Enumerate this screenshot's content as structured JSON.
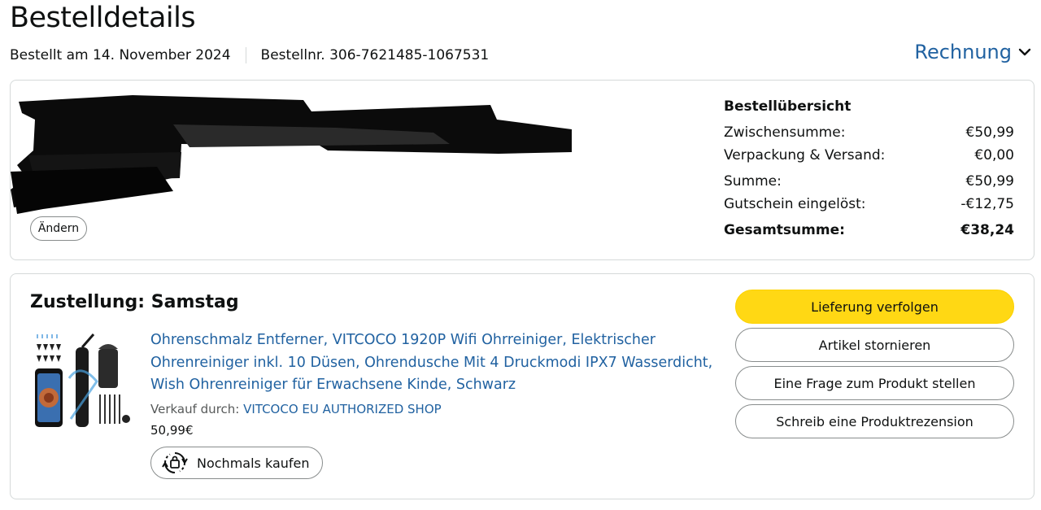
{
  "header": {
    "title": "Bestelldetails",
    "order_date": "Bestellt am 14. November 2024",
    "order_number": "Bestellnr. 306-7621485-1067531",
    "invoice_label": "Rechnung"
  },
  "address": {
    "change_label": "Ändern"
  },
  "summary": {
    "title": "Bestellübersicht",
    "rows": [
      {
        "label": "Zwischensumme:",
        "value": "€50,99"
      },
      {
        "label": "Verpackung & Versand:",
        "value": "€0,00"
      },
      {
        "label": "Summe:",
        "value": "€50,99"
      },
      {
        "label": "Gutschein eingelöst:",
        "value": "-€12,75"
      }
    ],
    "total_label": "Gesamtsumme:",
    "total_value": "€38,24"
  },
  "delivery": {
    "title": "Zustellung: Samstag",
    "product_title": "Ohrenschmalz Entferner, VITCOCO 1920P Wifi Ohrreiniger, Elektrischer Ohrenreiniger inkl. 10 Düsen, Ohrendusche Mit 4 Druckmodi IPX7 Wasserdicht, Wish Ohrenreiniger für Erwachsene Kinde, Schwarz",
    "seller_prefix": "Verkauf durch: ",
    "seller_name": "VITCOCO EU AUTHORIZED SHOP",
    "price": "50,99€",
    "buy_again_label": "Nochmals kaufen"
  },
  "actions": {
    "track": "Lieferung verfolgen",
    "cancel": "Artikel stornieren",
    "question": "Eine Frage zum Produkt stellen",
    "review": "Schreib eine Produktrezension"
  },
  "colors": {
    "link": "#2162a1",
    "primary_button": "#ffd814",
    "border": "#d5d9d9"
  }
}
